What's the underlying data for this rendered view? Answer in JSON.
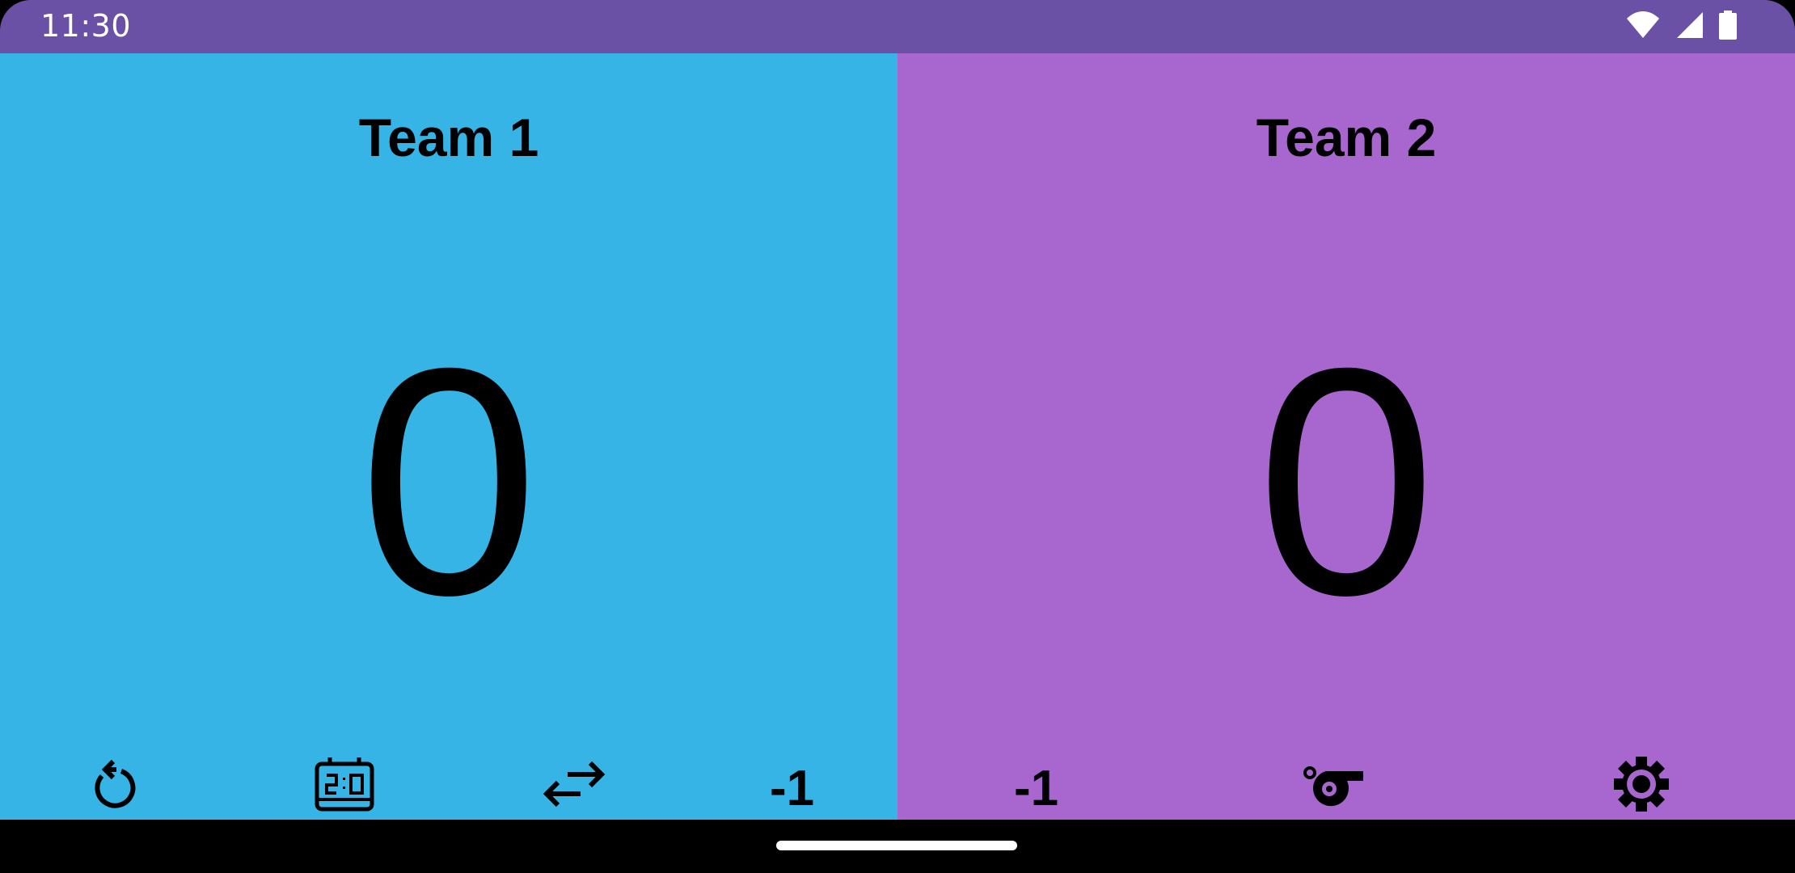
{
  "status_bar": {
    "time": "11:30",
    "icons": [
      "wifi-icon",
      "cellular-signal-icon",
      "battery-icon"
    ]
  },
  "teams": [
    {
      "name": "Team 1",
      "score": "0",
      "color": "#35b4e5"
    },
    {
      "name": "Team 2",
      "score": "0",
      "color": "#a866cf"
    }
  ],
  "controls": {
    "team1_minus_label": "-1",
    "team2_minus_label": "-1",
    "icons": [
      "reset-icon",
      "scoreboard-icon",
      "swap-icon",
      "whistle-icon",
      "settings-icon"
    ]
  },
  "colors": {
    "status_bar": "#6a51a5",
    "nav_bar": "#000000"
  }
}
